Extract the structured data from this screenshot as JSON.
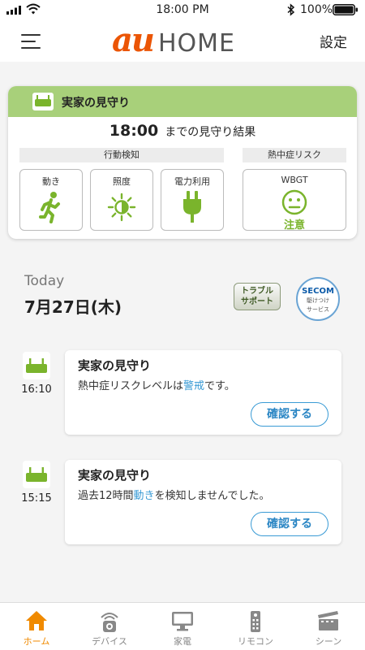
{
  "status_bar": {
    "time": "18:00 PM",
    "battery": "100%"
  },
  "header": {
    "logo_au": "au",
    "logo_home": "HOME",
    "settings_label": "設定"
  },
  "watch_card": {
    "title": "実家の見守り",
    "result_time": "18:00",
    "result_text": "までの見守り結果",
    "activity_heading": "行動検知",
    "heat_heading": "熱中症リスク",
    "tiles": [
      {
        "label": "動き",
        "icon": "running-person-icon"
      },
      {
        "label": "照度",
        "icon": "sun-icon"
      },
      {
        "label": "電力利用",
        "icon": "power-plug-icon"
      }
    ],
    "wbgt": {
      "label": "WBGT",
      "icon": "neutral-face-icon",
      "state": "注意"
    },
    "colors": {
      "header_green": "#a8d07a",
      "icon_green": "#7ab42c"
    }
  },
  "date_block": {
    "today_label": "Today",
    "date": "7月27日(木)"
  },
  "trouble_support": {
    "line1": "トラブル",
    "line2": "サポート"
  },
  "secom": {
    "brand": "SECOM",
    "line1": "駆けつけ",
    "line2": "サービス"
  },
  "feed": [
    {
      "time": "16:10",
      "title": "実家の見守り",
      "body_before": "熱中症リスクレベルは",
      "body_highlight": "警戒",
      "body_after": "です。",
      "button": "確認する"
    },
    {
      "time": "15:15",
      "title": "実家の見守り",
      "body_before": "過去12時間",
      "body_highlight": "動き",
      "body_after": "を検知しませんでした。",
      "button": "確認する"
    }
  ],
  "tabs": [
    {
      "label": "ホーム",
      "icon": "home-icon",
      "active": true
    },
    {
      "label": "デバイス",
      "icon": "device-camera-icon",
      "active": false
    },
    {
      "label": "家電",
      "icon": "tv-icon",
      "active": false
    },
    {
      "label": "リモコン",
      "icon": "remote-icon",
      "active": false
    },
    {
      "label": "シーン",
      "icon": "clapperboard-icon",
      "active": false
    }
  ],
  "accent_color": "#f08a00",
  "link_color": "#3a9bd5"
}
